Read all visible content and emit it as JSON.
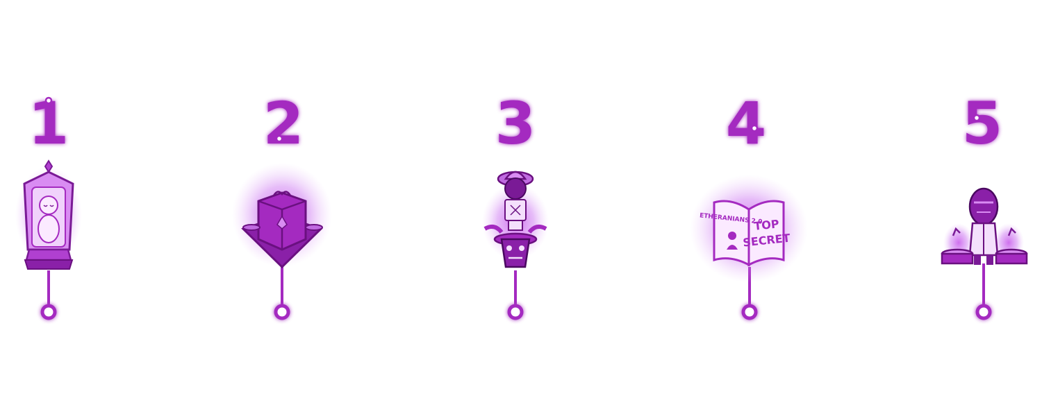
{
  "roadmap": {
    "accent_color": "#a42ac0",
    "glow_color": "#c040e8",
    "milestones": [
      {
        "number": "1",
        "icon": "glowing-capsule-figure-icon"
      },
      {
        "number": "2",
        "icon": "ethereum-gift-box-icon"
      },
      {
        "number": "3",
        "icon": "bucket-hat-character-on-totem-icon"
      },
      {
        "number": "4",
        "icon": "top-secret-book-icon",
        "book_left_text": "ETHERANIANS 2.0",
        "book_right_line1": "TOP",
        "book_right_line2": "SECRET"
      },
      {
        "number": "5",
        "icon": "robot-character-with-drums-icon"
      }
    ]
  }
}
